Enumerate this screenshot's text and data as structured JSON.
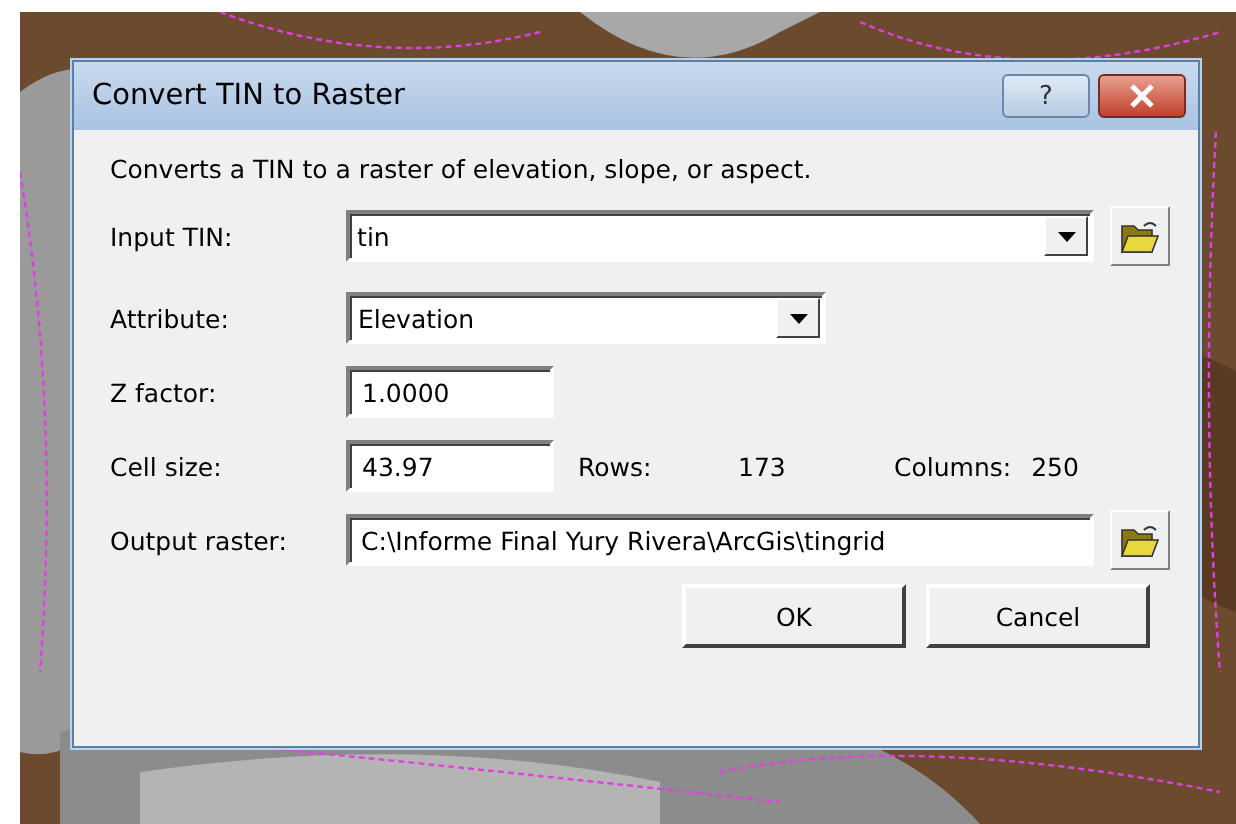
{
  "window": {
    "title": "Convert TIN to Raster",
    "help_button": "?"
  },
  "description": "Converts a TIN to a raster of elevation, slope, or aspect.",
  "input_tin": {
    "label": "Input TIN:",
    "value": "tin"
  },
  "attribute": {
    "label": "Attribute:",
    "value": "Elevation"
  },
  "z_factor": {
    "label": "Z factor:",
    "value": "1.0000"
  },
  "cell_size": {
    "label": "Cell size:",
    "value": "43.97",
    "rows_label": "Rows:",
    "rows": "173",
    "columns_label": "Columns:",
    "columns": "250"
  },
  "output_raster": {
    "label": "Output raster:",
    "value": "C:\\Informe Final Yury Rivera\\ArcGis\\tingrid"
  },
  "buttons": [
    "OK",
    "Cancel"
  ]
}
